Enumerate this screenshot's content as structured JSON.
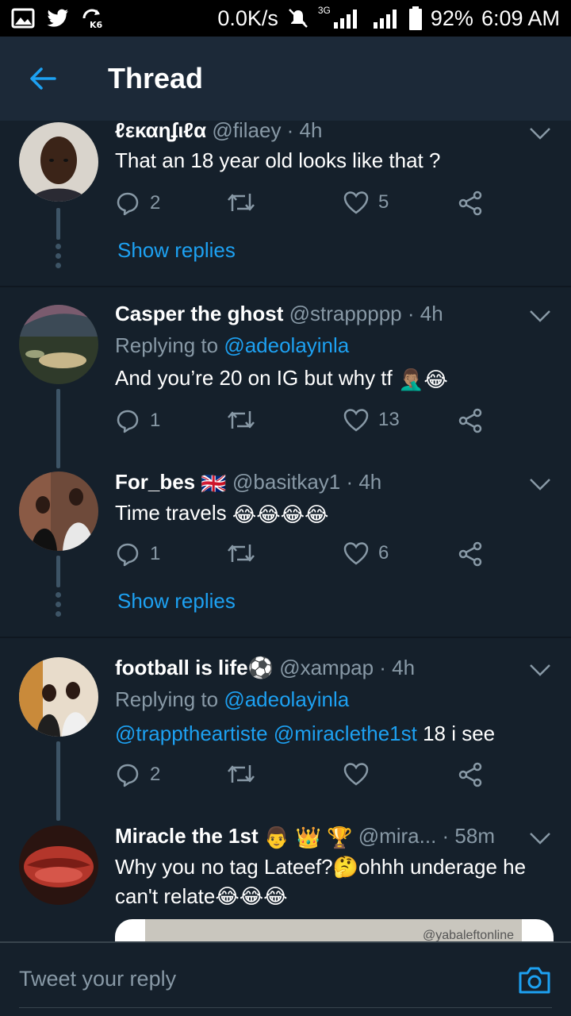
{
  "status_bar": {
    "speed": "0.0K/s",
    "network": "3G",
    "battery": "92%",
    "time": "6:09 AM"
  },
  "app_bar": {
    "title": "Thread"
  },
  "tweets": [
    {
      "name": "ℓεκαɳʄιℓα",
      "handle": "@filaey · 4h",
      "text": "That an 18 year old looks like that ?",
      "replies": "2",
      "retweets": "",
      "likes": "5",
      "show_replies": "Show replies"
    },
    {
      "name": "Casper the ghost",
      "handle": "@strappppp · 4h",
      "replying_prefix": "Replying to ",
      "replying_to": "@adeolayinla",
      "text": "And you’re 20 on IG but why tf ",
      "emoji_text": "🤦🏽‍♂️😂",
      "replies": "1",
      "retweets": "",
      "likes": "13"
    },
    {
      "name": "For_bes",
      "name_emoji": "🇬🇧",
      "handle": "@basitkay1 · 4h",
      "text": "Time travels ",
      "emoji_text": "😂😂😂😂",
      "replies": "1",
      "retweets": "",
      "likes": "6",
      "show_replies": "Show replies"
    },
    {
      "name": "football is life⚽",
      "handle": "@xampap · 4h",
      "replying_prefix": "Replying to ",
      "replying_to": "@adeolayinla",
      "mention_1": "@trapptheartiste",
      "mention_2": "@miraclethe1st",
      "text": " 18 i see",
      "replies": "2",
      "retweets": "",
      "likes": ""
    },
    {
      "name": "Miracle the 1st",
      "name_emoji": "👨‍ 👑 🏆",
      "handle": "@mira...",
      "time": "· 58m",
      "text_1": "Why you no tag Lateef?🤔ohhh underage he",
      "text_2": "can't relate😂😂😂",
      "media_watermark": "@yabaleftonline"
    }
  ],
  "composer": {
    "placeholder": "Tweet your reply"
  },
  "colors": {
    "background": "#15202b",
    "app_bar": "#1c2938",
    "accent": "#1da1f2",
    "muted": "#8899a6"
  }
}
